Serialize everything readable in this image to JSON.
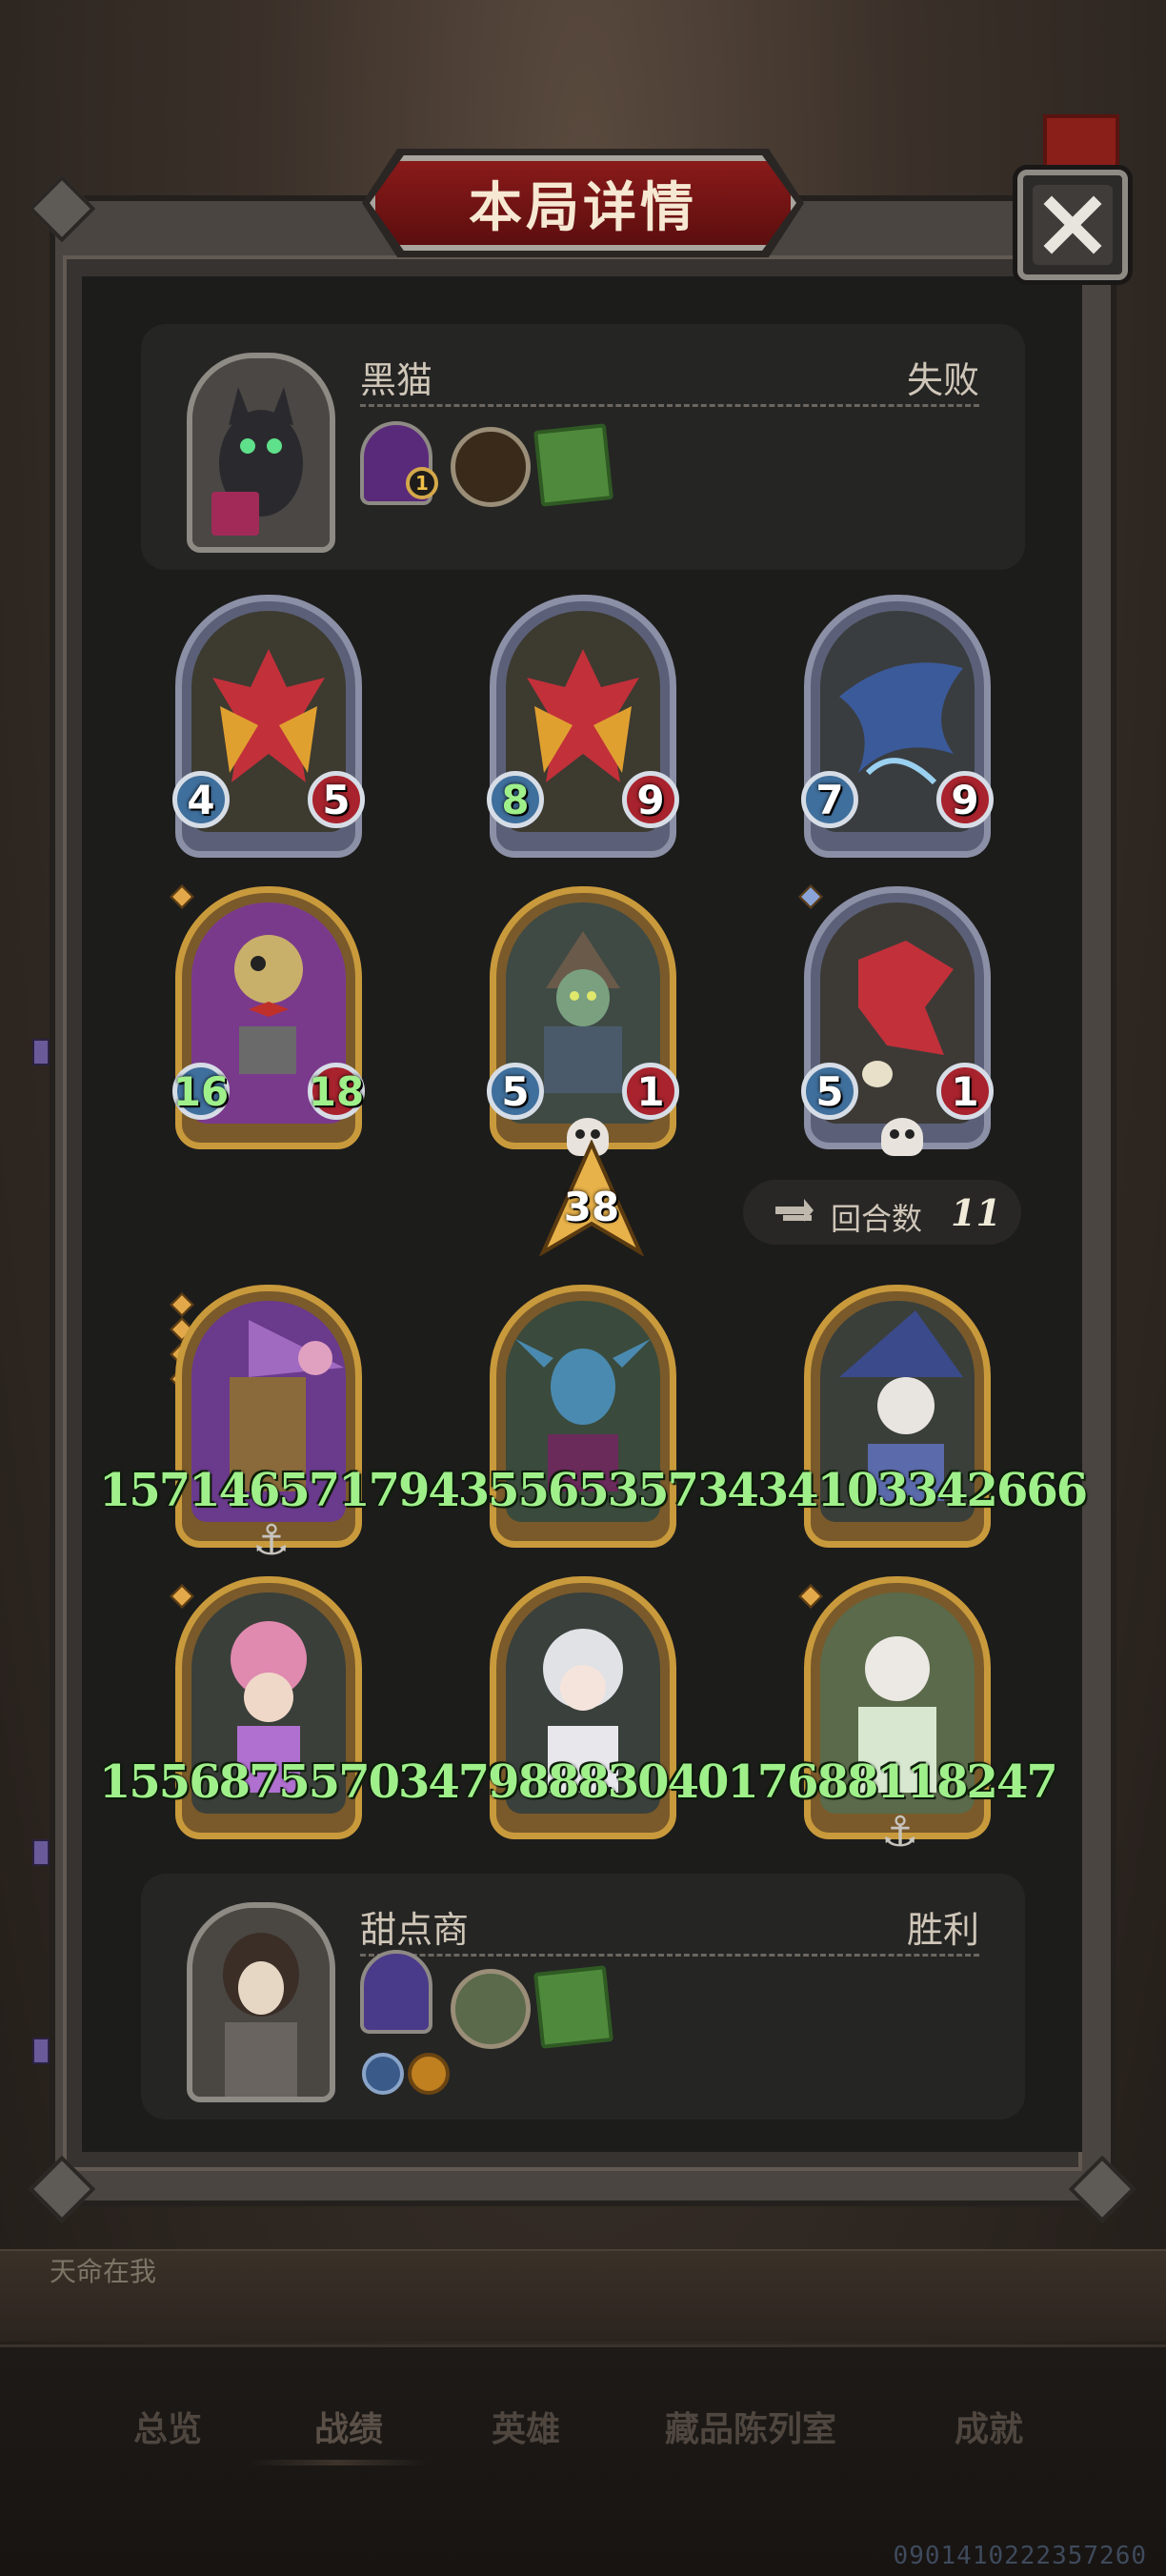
{
  "title": "本局详情",
  "opponent": {
    "name": "黑猫",
    "result": "失败",
    "item_level": "1"
  },
  "player": {
    "name": "甜点商",
    "result": "胜利"
  },
  "opponent_units": [
    {
      "name": "red-dragon",
      "atk": "4",
      "hp": "5",
      "frame": "silver"
    },
    {
      "name": "red-dragon",
      "atk": "8",
      "hp": "9",
      "frame": "silver"
    },
    {
      "name": "blue-dragon",
      "atk": "7",
      "hp": "9",
      "frame": "silver"
    },
    {
      "name": "puppet-robot",
      "atk": "16",
      "hp": "18",
      "frame": "gold"
    },
    {
      "name": "hooded-goblin",
      "atk": "5",
      "hp": "1",
      "frame": "gold"
    },
    {
      "name": "baby-red-dragon",
      "atk": "5",
      "hp": "1",
      "frame": "silver"
    }
  ],
  "player_units": [
    {
      "name": "scarecrow-witch",
      "frame": "gold"
    },
    {
      "name": "sea-elf",
      "frame": "gold"
    },
    {
      "name": "white-hair-mage",
      "frame": "gold"
    },
    {
      "name": "lotus-girl",
      "frame": "gold"
    },
    {
      "name": "pearl-girl",
      "frame": "gold"
    },
    {
      "name": "white-priestess",
      "frame": "gold"
    }
  ],
  "overflow_row_1": "157146571794355653573434103342666",
  "overflow_row_2": "15568755703479888304017688118247",
  "damage": "38",
  "round": {
    "label": "回合数",
    "value": "11"
  },
  "nav": [
    "总览",
    "战绩",
    "英雄",
    "藏品陈列室",
    "成就"
  ],
  "footer_id": "0901410222357260",
  "chat_hint": "天命在我"
}
